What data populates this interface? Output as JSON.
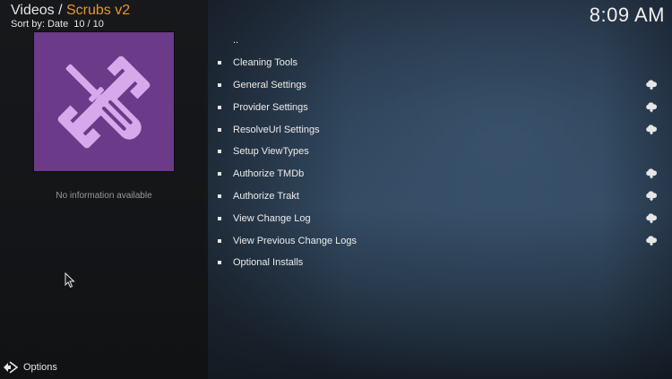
{
  "header": {
    "section": "Videos",
    "separator": " / ",
    "addon": "Scrubs v2",
    "sort_label": "Sort by: Date",
    "count": "10 / 10"
  },
  "clock": "8:09 AM",
  "info_text": "No information available",
  "options_label": "Options",
  "colors": {
    "accent": "#e8962a",
    "thumb_bg": "#6b3a88",
    "tool_icon": "#d8a8ec"
  },
  "list": {
    "parent": "..",
    "items": [
      {
        "label": "Cleaning Tools",
        "cloud": false
      },
      {
        "label": "General Settings",
        "cloud": true
      },
      {
        "label": "Provider Settings",
        "cloud": true
      },
      {
        "label": "ResolveUrl Settings",
        "cloud": true
      },
      {
        "label": "Setup ViewTypes",
        "cloud": false
      },
      {
        "label": "Authorize TMDb",
        "cloud": true
      },
      {
        "label": "Authorize Trakt",
        "cloud": true
      },
      {
        "label": "View Change Log",
        "cloud": true
      },
      {
        "label": "View Previous Change Logs",
        "cloud": true
      },
      {
        "label": "Optional Installs",
        "cloud": false
      }
    ]
  }
}
